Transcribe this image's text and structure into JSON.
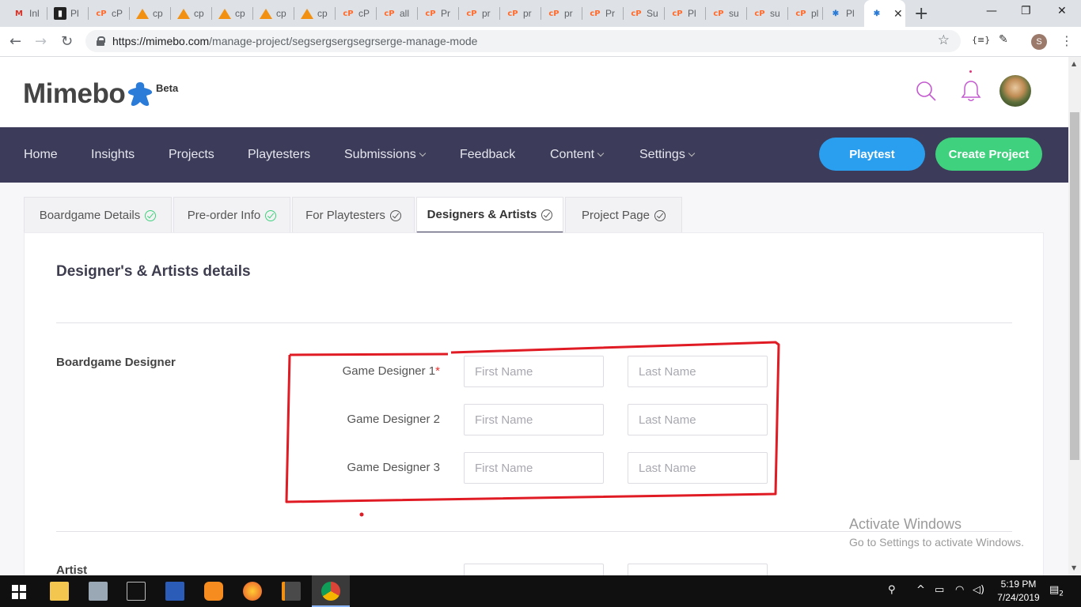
{
  "browser": {
    "tabs": [
      {
        "icon": "gmail-icon",
        "title": "Inl"
      },
      {
        "icon": "trello-icon",
        "title": "Pl"
      },
      {
        "icon": "cpanel-icon",
        "title": "cP"
      },
      {
        "icon": "phpmyadmin-icon",
        "title": "cp"
      },
      {
        "icon": "phpmyadmin-icon",
        "title": "cp"
      },
      {
        "icon": "phpmyadmin-icon",
        "title": "cp"
      },
      {
        "icon": "phpmyadmin-icon",
        "title": "cp"
      },
      {
        "icon": "phpmyadmin-icon",
        "title": "cp"
      },
      {
        "icon": "cpanel-icon",
        "title": "cP"
      },
      {
        "icon": "cpanel-icon",
        "title": "all"
      },
      {
        "icon": "cpanel-icon",
        "title": "Pr"
      },
      {
        "icon": "cpanel-icon",
        "title": "pr"
      },
      {
        "icon": "cpanel-icon",
        "title": "pr"
      },
      {
        "icon": "cpanel-icon",
        "title": "pr"
      },
      {
        "icon": "cpanel-icon",
        "title": "Pr"
      },
      {
        "icon": "cpanel-icon",
        "title": "Su"
      },
      {
        "icon": "cpanel-icon",
        "title": "Pl"
      },
      {
        "icon": "cpanel-icon",
        "title": "su"
      },
      {
        "icon": "cpanel-icon",
        "title": "su"
      },
      {
        "icon": "cpanel-icon",
        "title": "pl"
      },
      {
        "icon": "meeple-icon",
        "title": "Pl"
      }
    ],
    "url_host": "https://mimebo.com",
    "url_path": "/manage-project/segsergsergsegrserge-manage-mode",
    "profile_initial": "S"
  },
  "site": {
    "logo_text": "Mimebo",
    "beta_label": "Beta",
    "brand_blue": "#2b7bd8",
    "nav": {
      "items": [
        "Home",
        "Insights",
        "Projects",
        "Playtesters",
        "Submissions",
        "Feedback",
        "Content",
        "Settings"
      ],
      "playtest_label": "Playtest",
      "create_label": "Create Project"
    }
  },
  "steps": {
    "tabs": [
      "Boardgame Details",
      "Pre-order Info",
      "For Playtesters",
      "Designers & Artists",
      "Project Page"
    ]
  },
  "form": {
    "title": "Designer's & Artists details",
    "designer_section": "Boardgame Designer",
    "artist_section": "Artist",
    "required_mark": "*",
    "rows": [
      {
        "label": "Game Designer 1",
        "first": "First Name",
        "last": "Last Name"
      },
      {
        "label": "Game Designer 2",
        "first": "First Name",
        "last": "Last Name"
      },
      {
        "label": "Game Designer 3",
        "first": "First Name",
        "last": "Last Name"
      }
    ]
  },
  "watermark": {
    "line1": "Activate Windows",
    "line2": "Go to Settings to activate Windows."
  },
  "taskbar": {
    "time": "5:19 PM",
    "date": "7/24/2019",
    "notification_count": "2"
  }
}
